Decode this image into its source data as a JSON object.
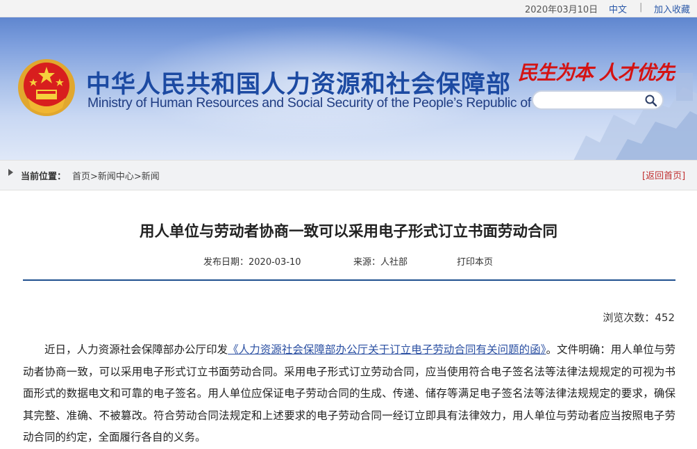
{
  "topbar": {
    "date": "2020年03月10日",
    "lang_label": "中文",
    "separator": "|",
    "favorite_label": "加入收藏"
  },
  "header": {
    "title_cn": "中华人民共和国人力资源和社会保障部",
    "title_en": "Ministry of Human Resources and Social Security of the People’s Republic of China",
    "slogan": "民生为本 人才优先",
    "search": {
      "value": "",
      "placeholder": ""
    },
    "emblem_icon": "national-emblem-icon",
    "search_icon": "search-icon"
  },
  "breadcrumb": {
    "label": "当前位置：",
    "path": "首页>新闻中心>新闻",
    "back_link": "[返回首页]"
  },
  "article": {
    "title": "用人单位与劳动者协商一致可以采用电子形式订立书面劳动合同",
    "publish_date": "发布日期：2020-03-10",
    "source": "来源：人社部",
    "print_label": "打印本页",
    "views": "浏览次数：452",
    "para_intro": "近日，人力资源社会保障部办公厅印发",
    "para_link": "《人力资源社会保障部办公厅关于订立电子劳动合同有关问题的函》",
    "para_rest": "。文件明确：用人单位与劳动者协商一致，可以采用电子形式订立书面劳动合同。采用电子形式订立劳动合同，应当使用符合电子签名法等法律法规规定的可视为书面形式的数据电文和可靠的电子签名。用人单位应保证电子劳动合同的生成、传递、储存等满足电子签名法等法律法规规定的要求，确保其完整、准确、不被篡改。符合劳动合同法规定和上述要求的电子劳动合同一经订立即具有法律效力，用人单位与劳动者应当按照电子劳动合同的约定，全面履行各自的义务。"
  },
  "colors": {
    "brand_blue": "#1c4aa2",
    "slogan_red": "#d41313",
    "divider": "#1e4f8e"
  }
}
